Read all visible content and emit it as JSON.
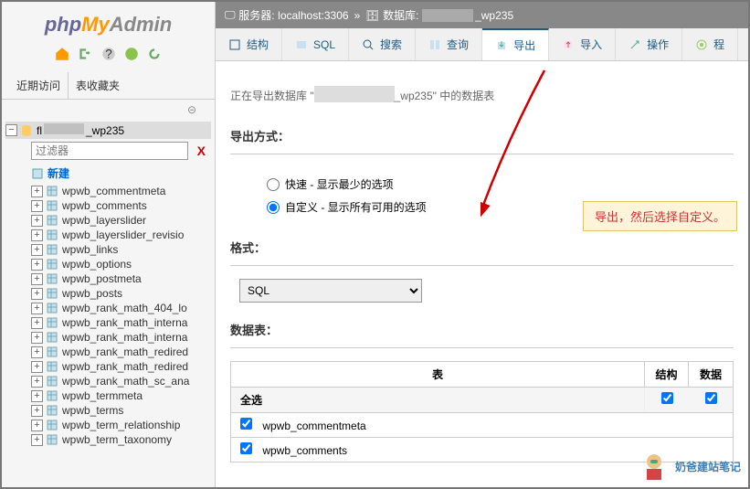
{
  "logo": {
    "part1": "php",
    "part2": "My",
    "part3": "Admin"
  },
  "sidebar": {
    "recent_tab": "近期访问",
    "fav_tab": "表收藏夹",
    "db_suffix": "_wp235",
    "db_prefix": "fl",
    "filter_placeholder": "过滤器",
    "new_label": "新建",
    "tables": [
      "wpwb_commentmeta",
      "wpwb_comments",
      "wpwb_layerslider",
      "wpwb_layerslider_revisio",
      "wpwb_links",
      "wpwb_options",
      "wpwb_postmeta",
      "wpwb_posts",
      "wpwb_rank_math_404_lo",
      "wpwb_rank_math_interna",
      "wpwb_rank_math_interna",
      "wpwb_rank_math_redired",
      "wpwb_rank_math_redired",
      "wpwb_rank_math_sc_ana",
      "wpwb_termmeta",
      "wpwb_terms",
      "wpwb_term_relationship",
      "wpwb_term_taxonomy"
    ]
  },
  "breadcrumb": {
    "server_label": "服务器:",
    "server_value": "localhost:3306",
    "db_label": "数据库:",
    "db_suffix": "_wp235"
  },
  "tabs": {
    "structure": "结构",
    "sql": "SQL",
    "search": "搜索",
    "query": "查询",
    "export": "导出",
    "import": "导入",
    "operations": "操作",
    "routines": "程"
  },
  "heading": {
    "prefix": "正在导出数据库 \"",
    "suffix": "_wp235\" 中的数据表"
  },
  "export_method": {
    "title": "导出方式：",
    "quick": "快速 - 显示最少的选项",
    "custom": "自定义 - 显示所有可用的选项"
  },
  "format": {
    "title": "格式：",
    "selected": "SQL"
  },
  "tables_section": {
    "title": "数据表：",
    "col_table": "表",
    "col_structure": "结构",
    "col_data": "数据",
    "select_all": "全选",
    "rows": [
      "wpwb_commentmeta",
      "wpwb_comments"
    ]
  },
  "annotation": "导出，然后选择自定义。",
  "watermark": "奶爸建站笔记"
}
